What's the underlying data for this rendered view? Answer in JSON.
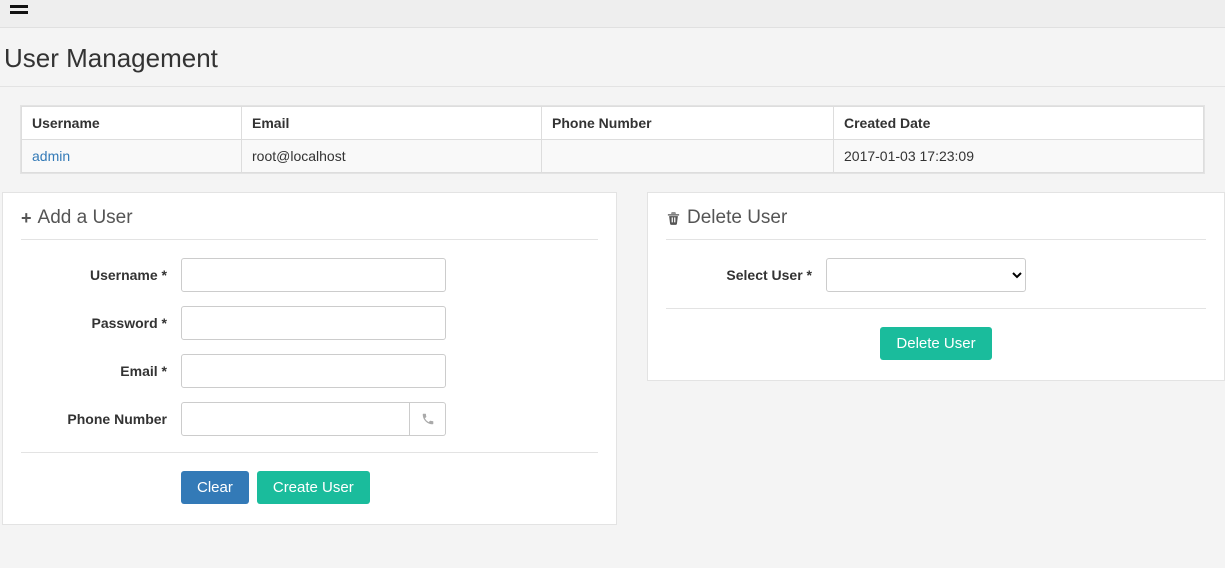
{
  "page": {
    "title": "User Management"
  },
  "table": {
    "headers": {
      "username": "Username",
      "email": "Email",
      "phone": "Phone Number",
      "created": "Created Date"
    },
    "row": {
      "username": "admin",
      "email": "root@localhost",
      "phone": "",
      "created": "2017-01-03 17:23:09"
    }
  },
  "addUser": {
    "title": "Add a User",
    "labels": {
      "username": "Username *",
      "password": "Password *",
      "email": "Email *",
      "phone": "Phone Number"
    },
    "buttons": {
      "clear": "Clear",
      "create": "Create User"
    }
  },
  "deleteUser": {
    "title": "Delete User",
    "labels": {
      "select": "Select User *"
    },
    "buttons": {
      "delete": "Delete User"
    }
  }
}
